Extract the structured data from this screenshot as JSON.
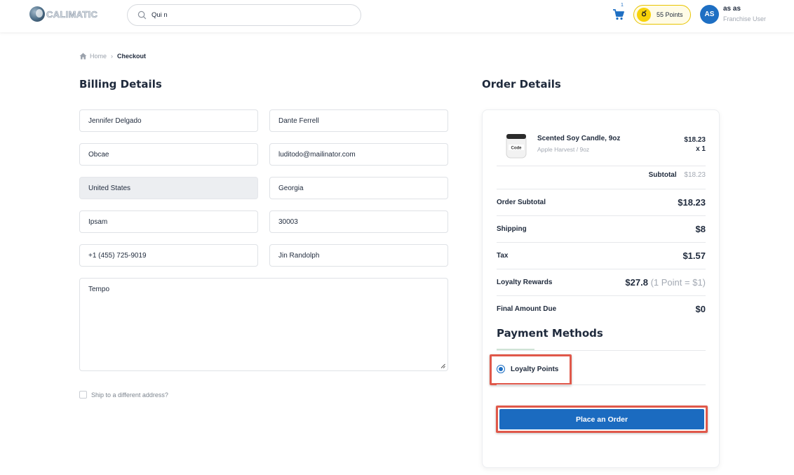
{
  "header": {
    "logo_text": "CALIMATIC",
    "search_value": "Qui n",
    "cart_count": "1",
    "points_label": "55 Points",
    "points_icon_glyph": "ర",
    "user_initials": "AS",
    "user_name": "as as",
    "user_role": "Franchise User"
  },
  "breadcrumb": {
    "home": "Home",
    "separator": "›",
    "current": "Checkout"
  },
  "billing": {
    "title": "Billing Details",
    "first_name": "Jennifer Delgado",
    "last_name": "Dante Ferrell",
    "company": "Obcae",
    "email": "luditodo@mailinator.com",
    "country": "United States",
    "state": "Georgia",
    "city": "Ipsam",
    "zip": "30003",
    "phone": "+1 (455) 725-9019",
    "contact_name": "Jin Randolph",
    "notes": "Tempo",
    "ship_different_label": "Ship to a different address?"
  },
  "order": {
    "title": "Order Details",
    "product": {
      "name": "Scented Soy Candle, 9oz",
      "variant": "Apple Harvest / 9oz",
      "price": "$18.23",
      "qty": "x 1",
      "thumb_label": "Code"
    },
    "subtotal_label": "Subtotal",
    "subtotal_value": "$18.23",
    "summary": {
      "order_subtotal_label": "Order Subtotal",
      "order_subtotal_value": "$18.23",
      "shipping_label": "Shipping",
      "shipping_value": "$8",
      "tax_label": "Tax",
      "tax_value": "$1.57",
      "loyalty_label": "Loyalty Rewards",
      "loyalty_value": "$27.8",
      "loyalty_note": "(1 Point = $1)",
      "final_label": "Final Amount Due",
      "final_value": "$0"
    },
    "payment_title": "Payment Methods",
    "payment_option": "Loyalty Points",
    "place_order_label": "Place an Order"
  },
  "colors": {
    "accent": "#1e6fc3",
    "highlight": "#e0584a",
    "points_yellow": "#f7d20a"
  }
}
